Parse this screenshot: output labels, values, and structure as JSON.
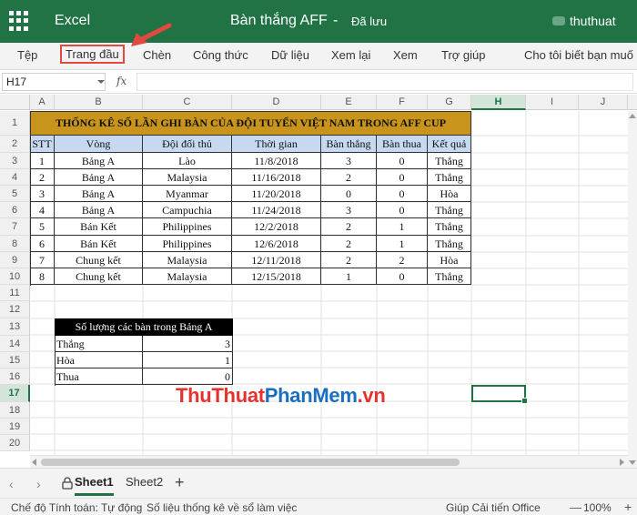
{
  "titlebar": {
    "app_name": "Excel",
    "doc_title": "Bàn thắng AFF",
    "separator": "-",
    "save_status": "Đã lưu",
    "user_name": "thuthuat",
    "bg_color": "#217346"
  },
  "ribbon": {
    "tabs": [
      {
        "label": "Tệp"
      },
      {
        "label": "Trang đầu",
        "active": true
      },
      {
        "label": "Chèn"
      },
      {
        "label": "Công thức"
      },
      {
        "label": "Dữ liệu"
      },
      {
        "label": "Xem lại"
      },
      {
        "label": "Xem"
      },
      {
        "label": "Trợ giúp"
      },
      {
        "label": "Cho tôi biết bạn muố"
      }
    ],
    "highlight_color": "#e04a3f"
  },
  "formula_bar": {
    "name_box": "H17",
    "fx_label": "fx",
    "formula": ""
  },
  "grid": {
    "columns": [
      "A",
      "B",
      "C",
      "D",
      "E",
      "F",
      "G",
      "H",
      "I",
      "J"
    ],
    "selected_column": "H",
    "rows": [
      "1",
      "2",
      "3",
      "4",
      "5",
      "6",
      "7",
      "8",
      "9",
      "10",
      "11",
      "12",
      "13",
      "14",
      "15",
      "16",
      "17",
      "18",
      "19",
      "20"
    ],
    "selected_row": "17",
    "active_cell": "H17"
  },
  "goals_table": {
    "title": "THỐNG KÊ SỐ LẦN GHI BÀN CỦA ĐỘI TUYỂN VIỆT NAM TRONG AFF CUP",
    "title_color": "#c9941c",
    "header_color": "#c6d9f0",
    "headers": [
      "STT",
      "Vòng",
      "Đội đối thủ",
      "Thời gian",
      "Bàn thắng",
      "Bàn thua",
      "Kết quả"
    ],
    "rows": [
      [
        "1",
        "Bảng A",
        "Lào",
        "11/8/2018",
        "3",
        "0",
        "Thắng"
      ],
      [
        "2",
        "Bảng A",
        "Malaysia",
        "11/16/2018",
        "2",
        "0",
        "Thắng"
      ],
      [
        "3",
        "Bảng A",
        "Myanmar",
        "11/20/2018",
        "0",
        "0",
        "Hòa"
      ],
      [
        "4",
        "Bảng A",
        "Campuchia",
        "11/24/2018",
        "3",
        "0",
        "Thắng"
      ],
      [
        "5",
        "Bán Kết",
        "Philippines",
        "12/2/2018",
        "2",
        "1",
        "Thắng"
      ],
      [
        "6",
        "Bán Kết",
        "Philippines",
        "12/6/2018",
        "2",
        "1",
        "Thắng"
      ],
      [
        "7",
        "Chung kết",
        "Malaysia",
        "12/11/2018",
        "2",
        "2",
        "Hòa"
      ],
      [
        "8",
        "Chung kết",
        "Malaysia",
        "12/15/2018",
        "1",
        "0",
        "Thắng"
      ]
    ]
  },
  "summary_table": {
    "title": "Số lượng các bàn trong Bảng A",
    "rows": [
      [
        "Thắng",
        "3"
      ],
      [
        "Hòa",
        "1"
      ],
      [
        "Thua",
        "0"
      ]
    ]
  },
  "watermark": {
    "part1": "ThuThuat",
    "part2": "PhanMem",
    "part3": ".vn",
    "color_red": "#e5322d",
    "color_blue": "#1b6fc1"
  },
  "sheets": {
    "tabs": [
      {
        "label": "Sheet1",
        "active": true
      },
      {
        "label": "Sheet2"
      }
    ],
    "add_label": "+"
  },
  "statusbar": {
    "calc_mode": "Chế độ Tính toán: Tự động",
    "stats": "Số liệu thống kê về sổ làm việc",
    "feedback": "Giúp Cải tiến Office",
    "zoom_minus": "—",
    "zoom": "100%",
    "zoom_plus": "+"
  }
}
